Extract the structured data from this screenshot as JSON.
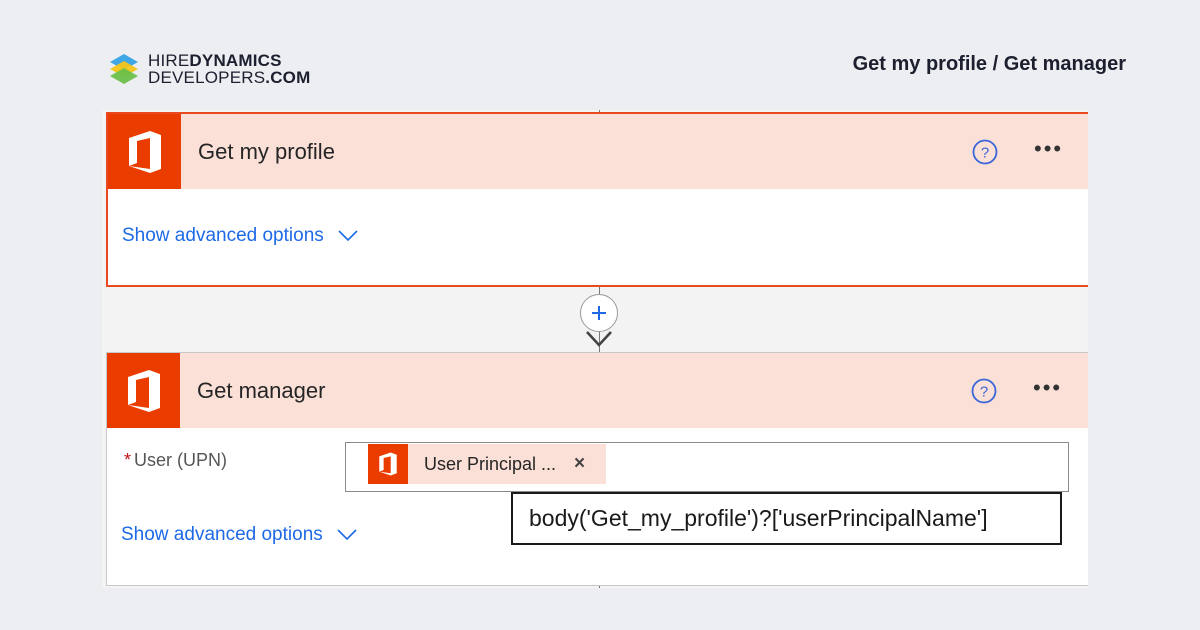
{
  "brand": {
    "line1_light": "HIRE",
    "line1_bold": "DYNAMICS",
    "line2_light": "DEVELOPERS",
    "line2_bold": ".COM"
  },
  "page_heading": "Get my profile / Get manager",
  "steps": [
    {
      "title": "Get my profile",
      "icon": "office-icon",
      "advanced_label": "Show advanced options"
    },
    {
      "title": "Get manager",
      "icon": "office-icon",
      "advanced_label": "Show advanced options",
      "field": {
        "label": "User (UPN)",
        "required_mark": "*",
        "token_label": "User Principal ...",
        "token_remove": "×"
      }
    }
  ],
  "tooltip": "body('Get_my_profile')?['userPrincipalName']",
  "colors": {
    "office_orange": "#eb3c00",
    "header_tint": "#fbe0d8",
    "selected_border": "#e8491d",
    "link_blue": "#1e6ae6"
  },
  "icons": {
    "help": "help-circle-icon",
    "more": "ellipsis-icon",
    "add": "plus-icon",
    "arrow": "arrow-down-icon",
    "chevron": "chevron-down-icon"
  }
}
